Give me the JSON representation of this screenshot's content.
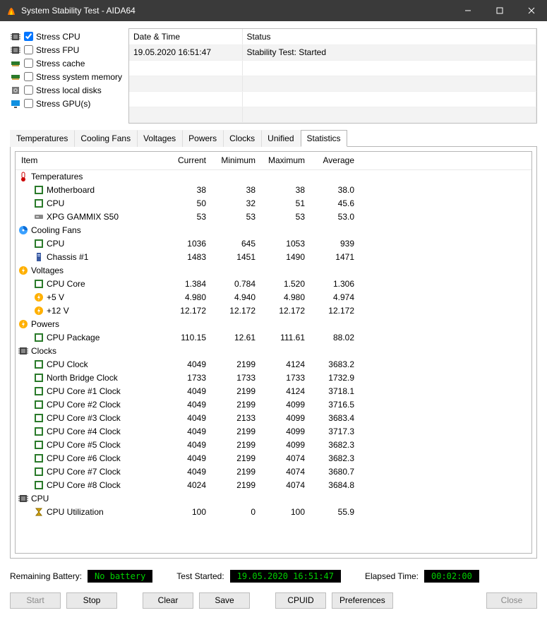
{
  "window": {
    "title": "System Stability Test - AIDA64"
  },
  "stress_checks": [
    {
      "label": "Stress CPU",
      "checked": true
    },
    {
      "label": "Stress FPU",
      "checked": false
    },
    {
      "label": "Stress cache",
      "checked": false
    },
    {
      "label": "Stress system memory",
      "checked": false
    },
    {
      "label": "Stress local disks",
      "checked": false
    },
    {
      "label": "Stress GPU(s)",
      "checked": false
    }
  ],
  "log": {
    "columns": {
      "datetime": "Date & Time",
      "status": "Status"
    },
    "rows": [
      {
        "datetime": "19.05.2020 16:51:47",
        "status": "Stability Test: Started"
      }
    ]
  },
  "tabs": [
    "Temperatures",
    "Cooling Fans",
    "Voltages",
    "Powers",
    "Clocks",
    "Unified",
    "Statistics"
  ],
  "active_tab": 6,
  "stats": {
    "columns": {
      "item": "Item",
      "current": "Current",
      "minimum": "Minimum",
      "maximum": "Maximum",
      "average": "Average"
    },
    "groups": [
      {
        "name": "Temperatures",
        "icon": "thermometer",
        "rows": [
          {
            "icon": "chip",
            "name": "Motherboard",
            "current": "38",
            "minimum": "38",
            "maximum": "38",
            "average": "38.0"
          },
          {
            "icon": "chip",
            "name": "CPU",
            "current": "50",
            "minimum": "32",
            "maximum": "51",
            "average": "45.6"
          },
          {
            "icon": "ssd",
            "name": "XPG GAMMIX S50",
            "current": "53",
            "minimum": "53",
            "maximum": "53",
            "average": "53.0"
          }
        ]
      },
      {
        "name": "Cooling Fans",
        "icon": "fan",
        "rows": [
          {
            "icon": "chip",
            "name": "CPU",
            "current": "1036",
            "minimum": "645",
            "maximum": "1053",
            "average": "939"
          },
          {
            "icon": "chassis",
            "name": "Chassis #1",
            "current": "1483",
            "minimum": "1451",
            "maximum": "1490",
            "average": "1471"
          }
        ]
      },
      {
        "name": "Voltages",
        "icon": "volt",
        "rows": [
          {
            "icon": "chip",
            "name": "CPU Core",
            "current": "1.384",
            "minimum": "0.784",
            "maximum": "1.520",
            "average": "1.306"
          },
          {
            "icon": "volt",
            "name": "+5 V",
            "current": "4.980",
            "minimum": "4.940",
            "maximum": "4.980",
            "average": "4.974"
          },
          {
            "icon": "volt",
            "name": "+12 V",
            "current": "12.172",
            "minimum": "12.172",
            "maximum": "12.172",
            "average": "12.172"
          }
        ]
      },
      {
        "name": "Powers",
        "icon": "volt",
        "rows": [
          {
            "icon": "chip",
            "name": "CPU Package",
            "current": "110.15",
            "minimum": "12.61",
            "maximum": "111.61",
            "average": "88.02"
          }
        ]
      },
      {
        "name": "Clocks",
        "icon": "cpu",
        "rows": [
          {
            "icon": "chip",
            "name": "CPU Clock",
            "current": "4049",
            "minimum": "2199",
            "maximum": "4124",
            "average": "3683.2"
          },
          {
            "icon": "chip",
            "name": "North Bridge Clock",
            "current": "1733",
            "minimum": "1733",
            "maximum": "1733",
            "average": "1732.9"
          },
          {
            "icon": "chip",
            "name": "CPU Core #1 Clock",
            "current": "4049",
            "minimum": "2199",
            "maximum": "4124",
            "average": "3718.1"
          },
          {
            "icon": "chip",
            "name": "CPU Core #2 Clock",
            "current": "4049",
            "minimum": "2199",
            "maximum": "4099",
            "average": "3716.5"
          },
          {
            "icon": "chip",
            "name": "CPU Core #3 Clock",
            "current": "4049",
            "minimum": "2133",
            "maximum": "4099",
            "average": "3683.4"
          },
          {
            "icon": "chip",
            "name": "CPU Core #4 Clock",
            "current": "4049",
            "minimum": "2199",
            "maximum": "4099",
            "average": "3717.3"
          },
          {
            "icon": "chip",
            "name": "CPU Core #5 Clock",
            "current": "4049",
            "minimum": "2199",
            "maximum": "4099",
            "average": "3682.3"
          },
          {
            "icon": "chip",
            "name": "CPU Core #6 Clock",
            "current": "4049",
            "minimum": "2199",
            "maximum": "4074",
            "average": "3682.3"
          },
          {
            "icon": "chip",
            "name": "CPU Core #7 Clock",
            "current": "4049",
            "minimum": "2199",
            "maximum": "4074",
            "average": "3680.7"
          },
          {
            "icon": "chip",
            "name": "CPU Core #8 Clock",
            "current": "4024",
            "minimum": "2199",
            "maximum": "4074",
            "average": "3684.8"
          }
        ]
      },
      {
        "name": "CPU",
        "icon": "cpu",
        "rows": [
          {
            "icon": "hourglass",
            "name": "CPU Utilization",
            "current": "100",
            "minimum": "0",
            "maximum": "100",
            "average": "55.9"
          }
        ]
      }
    ]
  },
  "status": {
    "battery_label": "Remaining Battery:",
    "battery_value": "No battery",
    "started_label": "Test Started:",
    "started_value": "19.05.2020 16:51:47",
    "elapsed_label": "Elapsed Time:",
    "elapsed_value": "00:02:00"
  },
  "buttons": {
    "start": "Start",
    "stop": "Stop",
    "clear": "Clear",
    "save": "Save",
    "cpuid": "CPUID",
    "preferences": "Preferences",
    "close": "Close"
  }
}
